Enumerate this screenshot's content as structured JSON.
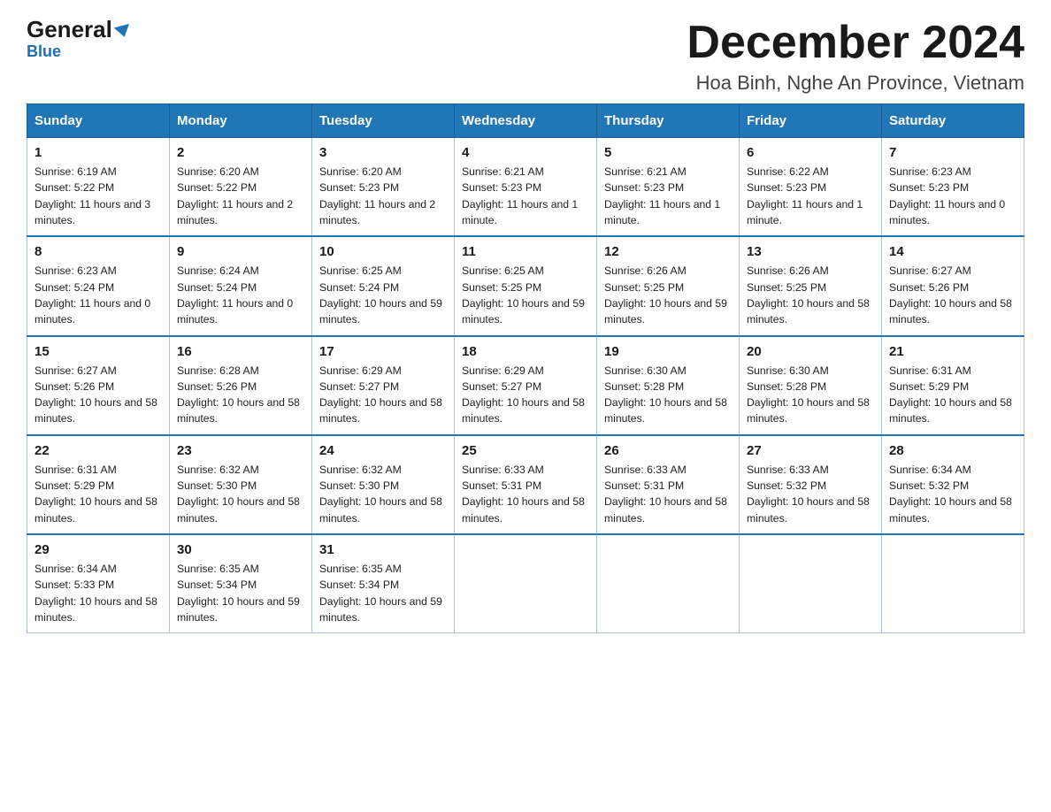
{
  "logo": {
    "brand": "General",
    "brand2": "Blue"
  },
  "header": {
    "title": "December 2024",
    "subtitle": "Hoa Binh, Nghe An Province, Vietnam"
  },
  "days_of_week": [
    "Sunday",
    "Monday",
    "Tuesday",
    "Wednesday",
    "Thursday",
    "Friday",
    "Saturday"
  ],
  "weeks": [
    [
      {
        "day": "1",
        "sunrise": "6:19 AM",
        "sunset": "5:22 PM",
        "daylight": "11 hours and 3 minutes."
      },
      {
        "day": "2",
        "sunrise": "6:20 AM",
        "sunset": "5:22 PM",
        "daylight": "11 hours and 2 minutes."
      },
      {
        "day": "3",
        "sunrise": "6:20 AM",
        "sunset": "5:23 PM",
        "daylight": "11 hours and 2 minutes."
      },
      {
        "day": "4",
        "sunrise": "6:21 AM",
        "sunset": "5:23 PM",
        "daylight": "11 hours and 1 minute."
      },
      {
        "day": "5",
        "sunrise": "6:21 AM",
        "sunset": "5:23 PM",
        "daylight": "11 hours and 1 minute."
      },
      {
        "day": "6",
        "sunrise": "6:22 AM",
        "sunset": "5:23 PM",
        "daylight": "11 hours and 1 minute."
      },
      {
        "day": "7",
        "sunrise": "6:23 AM",
        "sunset": "5:23 PM",
        "daylight": "11 hours and 0 minutes."
      }
    ],
    [
      {
        "day": "8",
        "sunrise": "6:23 AM",
        "sunset": "5:24 PM",
        "daylight": "11 hours and 0 minutes."
      },
      {
        "day": "9",
        "sunrise": "6:24 AM",
        "sunset": "5:24 PM",
        "daylight": "11 hours and 0 minutes."
      },
      {
        "day": "10",
        "sunrise": "6:25 AM",
        "sunset": "5:24 PM",
        "daylight": "10 hours and 59 minutes."
      },
      {
        "day": "11",
        "sunrise": "6:25 AM",
        "sunset": "5:25 PM",
        "daylight": "10 hours and 59 minutes."
      },
      {
        "day": "12",
        "sunrise": "6:26 AM",
        "sunset": "5:25 PM",
        "daylight": "10 hours and 59 minutes."
      },
      {
        "day": "13",
        "sunrise": "6:26 AM",
        "sunset": "5:25 PM",
        "daylight": "10 hours and 58 minutes."
      },
      {
        "day": "14",
        "sunrise": "6:27 AM",
        "sunset": "5:26 PM",
        "daylight": "10 hours and 58 minutes."
      }
    ],
    [
      {
        "day": "15",
        "sunrise": "6:27 AM",
        "sunset": "5:26 PM",
        "daylight": "10 hours and 58 minutes."
      },
      {
        "day": "16",
        "sunrise": "6:28 AM",
        "sunset": "5:26 PM",
        "daylight": "10 hours and 58 minutes."
      },
      {
        "day": "17",
        "sunrise": "6:29 AM",
        "sunset": "5:27 PM",
        "daylight": "10 hours and 58 minutes."
      },
      {
        "day": "18",
        "sunrise": "6:29 AM",
        "sunset": "5:27 PM",
        "daylight": "10 hours and 58 minutes."
      },
      {
        "day": "19",
        "sunrise": "6:30 AM",
        "sunset": "5:28 PM",
        "daylight": "10 hours and 58 minutes."
      },
      {
        "day": "20",
        "sunrise": "6:30 AM",
        "sunset": "5:28 PM",
        "daylight": "10 hours and 58 minutes."
      },
      {
        "day": "21",
        "sunrise": "6:31 AM",
        "sunset": "5:29 PM",
        "daylight": "10 hours and 58 minutes."
      }
    ],
    [
      {
        "day": "22",
        "sunrise": "6:31 AM",
        "sunset": "5:29 PM",
        "daylight": "10 hours and 58 minutes."
      },
      {
        "day": "23",
        "sunrise": "6:32 AM",
        "sunset": "5:30 PM",
        "daylight": "10 hours and 58 minutes."
      },
      {
        "day": "24",
        "sunrise": "6:32 AM",
        "sunset": "5:30 PM",
        "daylight": "10 hours and 58 minutes."
      },
      {
        "day": "25",
        "sunrise": "6:33 AM",
        "sunset": "5:31 PM",
        "daylight": "10 hours and 58 minutes."
      },
      {
        "day": "26",
        "sunrise": "6:33 AM",
        "sunset": "5:31 PM",
        "daylight": "10 hours and 58 minutes."
      },
      {
        "day": "27",
        "sunrise": "6:33 AM",
        "sunset": "5:32 PM",
        "daylight": "10 hours and 58 minutes."
      },
      {
        "day": "28",
        "sunrise": "6:34 AM",
        "sunset": "5:32 PM",
        "daylight": "10 hours and 58 minutes."
      }
    ],
    [
      {
        "day": "29",
        "sunrise": "6:34 AM",
        "sunset": "5:33 PM",
        "daylight": "10 hours and 58 minutes."
      },
      {
        "day": "30",
        "sunrise": "6:35 AM",
        "sunset": "5:34 PM",
        "daylight": "10 hours and 59 minutes."
      },
      {
        "day": "31",
        "sunrise": "6:35 AM",
        "sunset": "5:34 PM",
        "daylight": "10 hours and 59 minutes."
      },
      {
        "day": "",
        "sunrise": "",
        "sunset": "",
        "daylight": ""
      },
      {
        "day": "",
        "sunrise": "",
        "sunset": "",
        "daylight": ""
      },
      {
        "day": "",
        "sunrise": "",
        "sunset": "",
        "daylight": ""
      },
      {
        "day": "",
        "sunrise": "",
        "sunset": "",
        "daylight": ""
      }
    ]
  ],
  "labels": {
    "sunrise_prefix": "Sunrise: ",
    "sunset_prefix": "Sunset: ",
    "daylight_prefix": "Daylight: "
  }
}
